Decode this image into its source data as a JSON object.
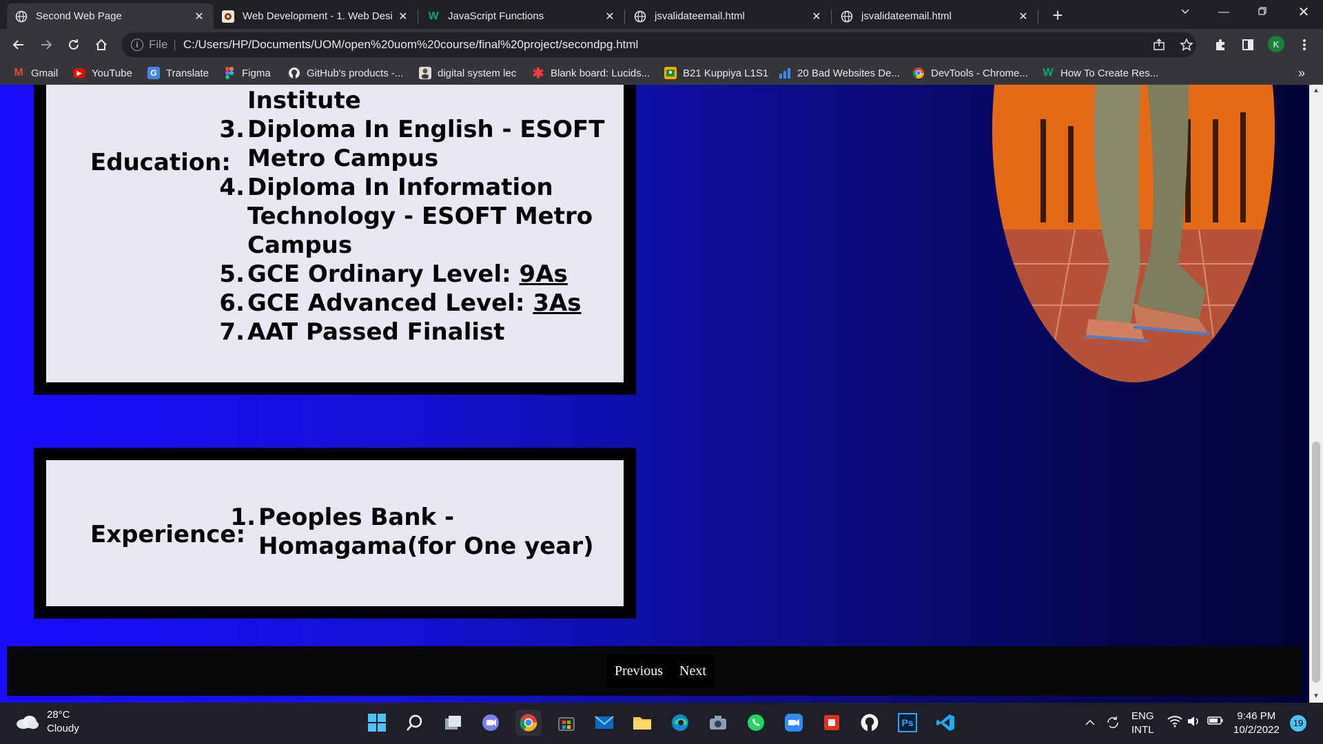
{
  "browser": {
    "tabs": [
      {
        "title": "Second Web Page",
        "icon": "globe-icon",
        "active": true
      },
      {
        "title": "Web Development - 1. Web Desi",
        "icon": "university-icon",
        "active": false
      },
      {
        "title": "JavaScript Functions",
        "icon": "w3schools-icon",
        "active": false
      },
      {
        "title": "jsvalidateemail.html",
        "icon": "globe-icon",
        "active": false
      },
      {
        "title": "jsvalidateemail.html",
        "icon": "globe-icon",
        "active": false
      }
    ],
    "address": {
      "scheme_label": "File",
      "url": "C:/Users/HP/Documents/UOM/open%20uom%20course/final%20project/secondpg.html"
    },
    "profile_initial": "K",
    "bookmarks": [
      {
        "label": "Gmail",
        "icon": "gmail-icon"
      },
      {
        "label": "YouTube",
        "icon": "youtube-icon"
      },
      {
        "label": "Translate",
        "icon": "translate-icon"
      },
      {
        "label": "Figma",
        "icon": "figma-icon"
      },
      {
        "label": "GitHub's products -...",
        "icon": "github-icon"
      },
      {
        "label": "digital system lec",
        "icon": "profile-photo-icon"
      },
      {
        "label": "Blank board: Lucids...",
        "icon": "lucid-icon"
      },
      {
        "label": "B21 Kuppiya L1S1",
        "icon": "classroom-icon"
      },
      {
        "label": "20 Bad Websites De...",
        "icon": "chart-bars-icon"
      },
      {
        "label": "DevTools - Chrome...",
        "icon": "chrome-icon"
      },
      {
        "label": "How To Create Res...",
        "icon": "w3schools-icon"
      }
    ],
    "more_bookmarks": "»"
  },
  "page": {
    "education": {
      "label": "Education:",
      "partial_item": "Institute",
      "items": [
        {
          "num": "3.",
          "lines": [
            "Diploma In English - ESOFT",
            "Metro Campus"
          ]
        },
        {
          "num": "4.",
          "lines": [
            "Diploma In Information",
            "Technology - ESOFT Metro",
            "Campus"
          ]
        },
        {
          "num": "5.",
          "text": "GCE Ordinary Level: ",
          "link": "9As"
        },
        {
          "num": "6.",
          "text": "GCE Advanced Level: ",
          "link": "3As"
        },
        {
          "num": "7.",
          "text": "AAT Passed Finalist"
        }
      ]
    },
    "experience": {
      "label": "Experience:",
      "items": [
        {
          "num": "1.",
          "lines": [
            "Peoples Bank -",
            "Homagama(for One year)"
          ]
        }
      ]
    },
    "footer": {
      "previous": "Previous",
      "next": "Next"
    }
  },
  "taskbar": {
    "weather": {
      "temp": "28°C",
      "condition": "Cloudy"
    },
    "language": {
      "line1": "ENG",
      "line2": "INTL"
    },
    "clock": {
      "time": "9:46 PM",
      "date": "10/2/2022"
    },
    "notifications": "19",
    "apps": [
      "start-icon",
      "search-icon",
      "task-view-icon",
      "chat-icon",
      "chrome-icon",
      "store-icon",
      "mail-icon",
      "file-explorer-icon",
      "edge-icon",
      "camera-icon",
      "whatsapp-icon",
      "zoom-icon",
      "recorder-icon",
      "github-desktop-icon",
      "photoshop-icon",
      "vscode-icon"
    ]
  }
}
